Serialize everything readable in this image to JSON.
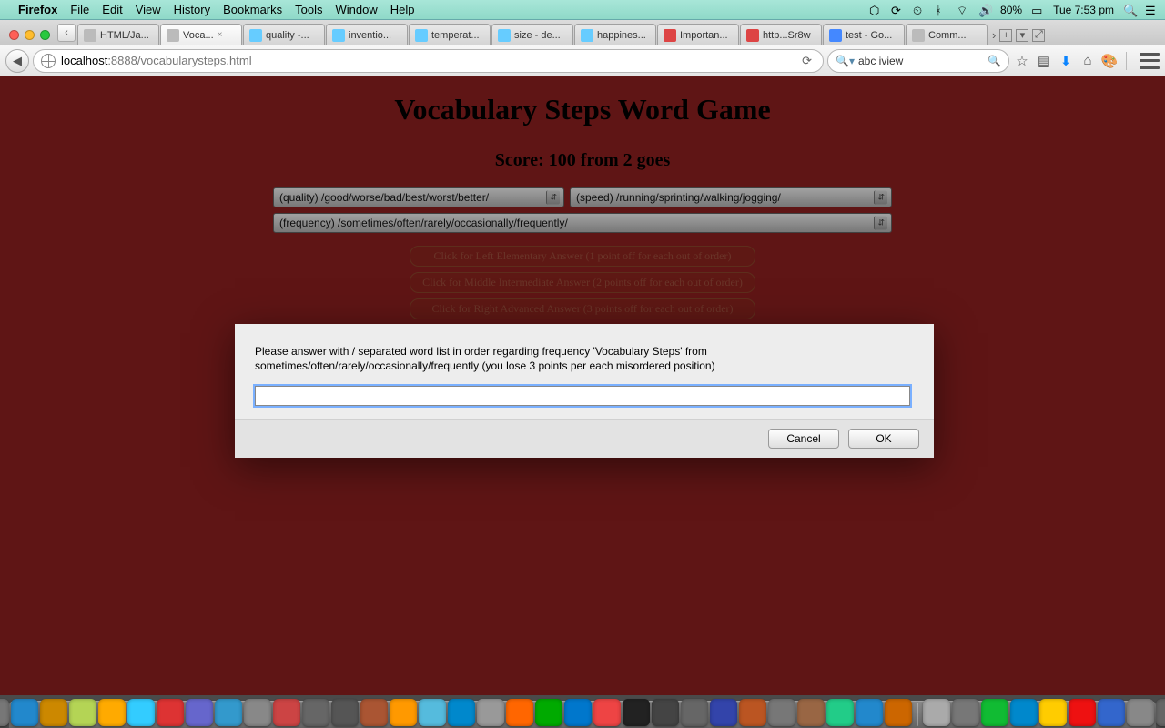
{
  "menubar": {
    "app": "Firefox",
    "items": [
      "File",
      "Edit",
      "View",
      "History",
      "Bookmarks",
      "Tools",
      "Window",
      "Help"
    ],
    "battery": "80%",
    "clock": "Tue 7:53 pm"
  },
  "tabs": [
    {
      "label": "HTML/Ja...",
      "favicon": "plain",
      "active": false
    },
    {
      "label": "Voca...",
      "favicon": "plain",
      "active": true
    },
    {
      "label": "quality -...",
      "favicon": "m",
      "active": false
    },
    {
      "label": "inventio...",
      "favicon": "m",
      "active": false
    },
    {
      "label": "temperat...",
      "favicon": "m",
      "active": false
    },
    {
      "label": "size - de...",
      "favicon": "m",
      "active": false
    },
    {
      "label": "happines...",
      "favicon": "m",
      "active": false
    },
    {
      "label": "Importan...",
      "favicon": "g",
      "active": false
    },
    {
      "label": "http...Sr8w",
      "favicon": "g",
      "active": false
    },
    {
      "label": "test - Go...",
      "favicon": "b",
      "active": false
    },
    {
      "label": "Comm...",
      "favicon": "plain",
      "active": false
    }
  ],
  "url": {
    "host": "localhost",
    "port": ":8888",
    "path": "/vocabularysteps.html"
  },
  "search": {
    "value": "abc iview"
  },
  "page": {
    "title": "Vocabulary Steps Word Game",
    "score_line": "Score: 100 from 2 goes",
    "selects": [
      {
        "cls": "w1",
        "text": "(quality) /good/worse/bad/best/worst/better/"
      },
      {
        "cls": "w2",
        "text": "(speed) /running/sprinting/walking/jogging/"
      },
      {
        "cls": "w3",
        "text": "(frequency) /sometimes/often/rarely/occasionally/frequently/"
      }
    ],
    "hints": [
      "Click for Left Elementary Answer (1 point off for each out of order)",
      "Click for Middle Intermediate Answer (2 points off for each out of order)",
      "Click for Right Advanced Answer (3 points off for each out of order)"
    ]
  },
  "modal": {
    "message": "Please answer with / separated word list in order regarding frequency 'Vocabulary Steps' from sometimes/often/rarely/occasionally/frequently (you lose 3 points per each misordered position)",
    "input_value": "",
    "cancel": "Cancel",
    "ok": "OK"
  },
  "dock_colors": [
    "#3b6ea5",
    "#555",
    "#5a8",
    "#c33",
    "#48a",
    "#777",
    "#28c",
    "#c80",
    "#b4d455",
    "#fa0",
    "#3cf",
    "#d33",
    "#66c",
    "#39c",
    "#888",
    "#c44",
    "#666",
    "#555",
    "#a53",
    "#f90",
    "#5bd",
    "#08c",
    "#999",
    "#f60",
    "#0a0",
    "#07c",
    "#e44",
    "#222",
    "#444",
    "#666",
    "#34a",
    "#b52",
    "#777",
    "#964",
    "#2c8",
    "#28c",
    "#c60",
    "#aaa",
    "#777",
    "#1b3",
    "#08c",
    "#fc0",
    "#e11",
    "#36c",
    "#888",
    "#666",
    "#aaa",
    "#999",
    "#777",
    "#555",
    "#888"
  ]
}
